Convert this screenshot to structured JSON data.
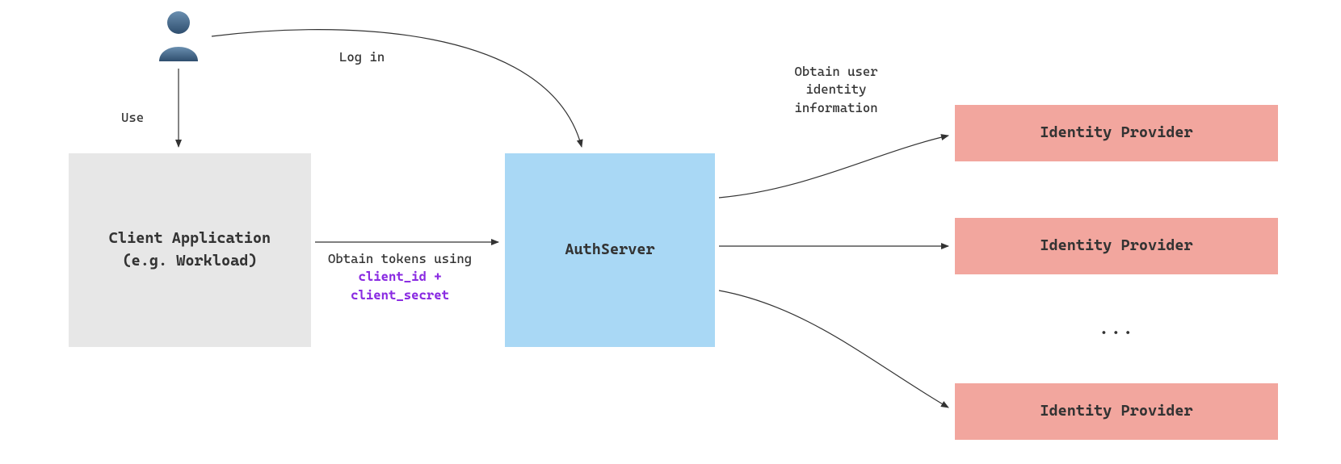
{
  "nodes": {
    "user_icon": "user-icon",
    "client_app_line1": "Client Application",
    "client_app_line2": "(e.g. Workload)",
    "auth_server": "AuthServer",
    "identity_provider_1": "Identity Provider",
    "identity_provider_2": "Identity Provider",
    "identity_provider_3": "Identity Provider",
    "ellipsis": "..."
  },
  "edges": {
    "use": "Use",
    "login": "Log in",
    "tokens_prefix": "Obtain tokens using ",
    "tokens_kw1": "client_id",
    "tokens_join": " + ",
    "tokens_kw2": "client_secret",
    "id_info": "Obtain user identity information"
  },
  "colors": {
    "client_bg": "#e7e7e7",
    "auth_bg": "#a9d8f5",
    "idp_bg": "#f2a69e",
    "keyword": "#8a2be2",
    "user_fill": "#4a6a8a"
  }
}
